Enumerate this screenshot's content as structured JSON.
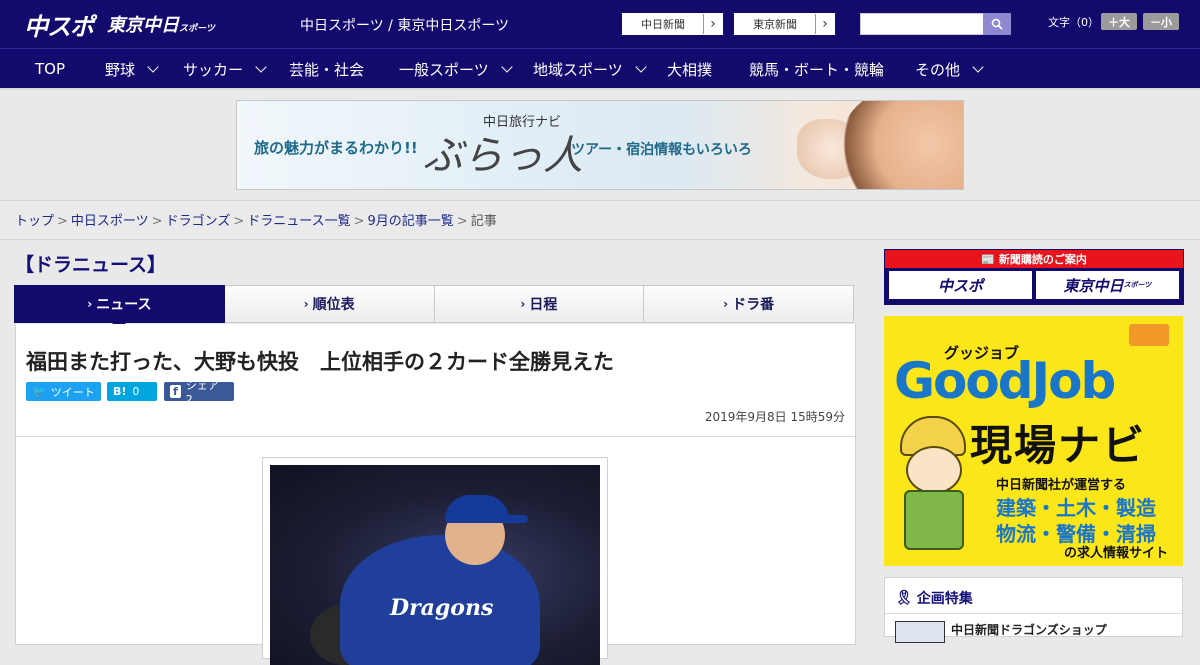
{
  "header": {
    "logo_main": "中スポ",
    "logo_tokyo": "東京中日",
    "logo_tokyo_suffix": "スポーツ",
    "site_name": "中日スポーツ / 東京中日スポーツ",
    "paper_links": [
      "中日新聞",
      "東京新聞"
    ],
    "search_placeholder": "",
    "font_label": "文字（0）",
    "font_bigger": "＋大",
    "font_smaller": "－小"
  },
  "nav": {
    "items": [
      {
        "label": "TOP",
        "has_menu": false
      },
      {
        "label": "野球",
        "has_menu": true
      },
      {
        "label": "サッカー",
        "has_menu": true
      },
      {
        "label": "芸能・社会",
        "has_menu": false
      },
      {
        "label": "一般スポーツ",
        "has_menu": true
      },
      {
        "label": "地域スポーツ",
        "has_menu": true
      },
      {
        "label": "大相撲",
        "has_menu": false
      },
      {
        "label": "競馬・ボート・競輪",
        "has_menu": false
      },
      {
        "label": "その他",
        "has_menu": true
      }
    ]
  },
  "banner": {
    "left_text": "旅の魅力がまるわかり!!",
    "small_text": "中日旅行ナビ",
    "big_text": "ぶらっ人",
    "right_text": "ツアー・宿泊情報もいろいろ"
  },
  "breadcrumb": {
    "links": [
      "トップ",
      "中日スポーツ",
      "ドラゴンズ",
      "ドラニュース一覧",
      "9月の記事一覧"
    ],
    "current": "記事"
  },
  "section": {
    "title": "【ドラニュース】",
    "tabs": [
      {
        "label": "ニュース",
        "active": true
      },
      {
        "label": "順位表",
        "active": false
      },
      {
        "label": "日程",
        "active": false
      },
      {
        "label": "ドラ番",
        "active": false
      }
    ]
  },
  "article": {
    "headline": "福田また打った、大野も快投　上位相手の２カード全勝見えた",
    "share_tweet": "ツイート",
    "share_hatena_count": "0",
    "share_facebook": "シェア 2",
    "date": "2019年9月8日 15時59分",
    "photo_caption_text": "Dragons"
  },
  "sidebar": {
    "subscribe_head": "新聞購読のご案内",
    "subscribe_left": "中スポ",
    "subscribe_right": "東京中日",
    "subscribe_right_suffix": "スポーツ",
    "goodjob_kana": "グッジョブ",
    "goodjob_title": "GoodJob",
    "goodjob_navi": "現場ナビ",
    "goodjob_small": "中日新聞社が運営する",
    "goodjob_line1": "建築・土木・製造",
    "goodjob_line2": "物流・警備・清掃",
    "goodjob_foot": "の求人情報サイト",
    "feature_title": "企画特集",
    "feature_item": "中日新聞ドラゴンズショップ"
  },
  "colors": {
    "header_bg": "#130a6e",
    "accent_red": "#e8141c",
    "goodjob_yellow": "#fbe61a",
    "goodjob_blue": "#1a76c9",
    "twitter": "#1da1f2",
    "hatena": "#00a4de",
    "facebook": "#3b5998"
  }
}
